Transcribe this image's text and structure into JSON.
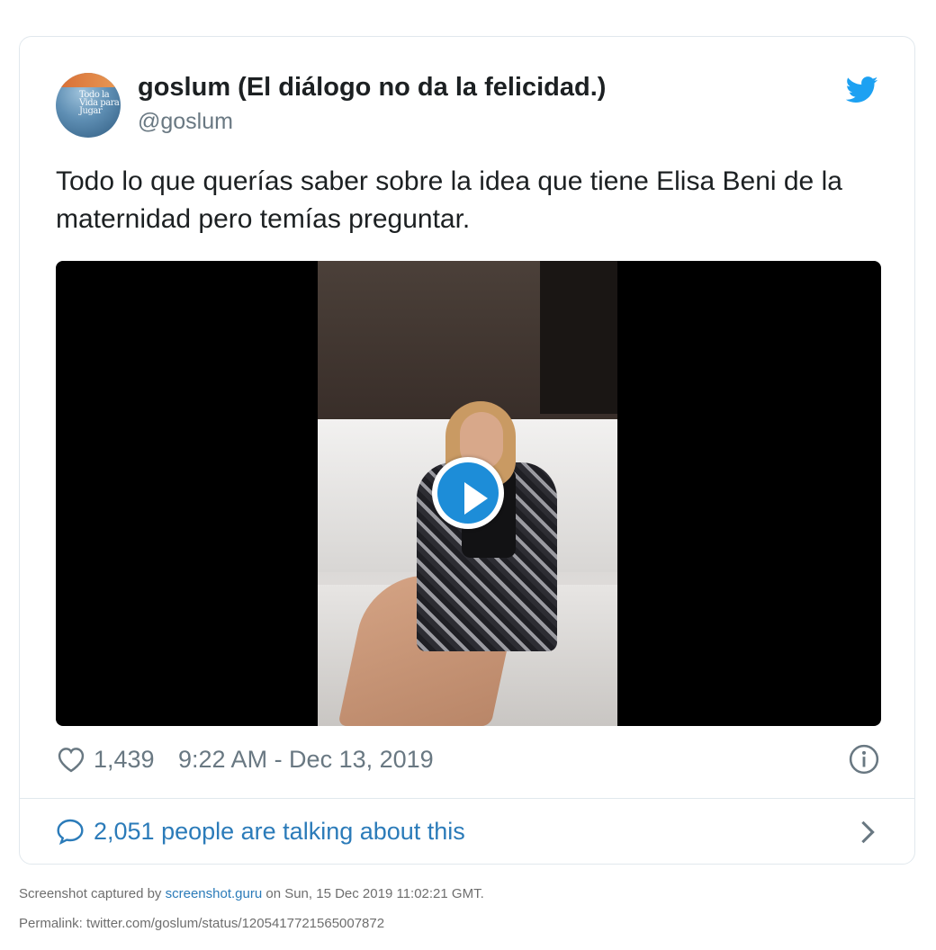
{
  "tweet": {
    "author_name": "goslum (El diálogo no da la felicidad.)",
    "author_handle": "@goslum",
    "avatar_text": "Todo la Vida para Jugar",
    "text": "Todo lo que querías saber sobre la idea que tiene Elisa Beni de la maternidad pero temías preguntar.",
    "like_count": "1,439",
    "timestamp": "9:22 AM - Dec 13, 2019",
    "talking_text": "2,051 people are talking about this",
    "icons": {
      "brand": "twitter-bird-icon",
      "like": "heart-icon",
      "info": "info-icon",
      "reply": "speech-bubble-icon",
      "navigate": "chevron-right-icon",
      "video": "play-icon"
    },
    "colors": {
      "brand": "#1da1f2",
      "link": "#2b7bb9",
      "muted": "#697882",
      "play_button": "#1d8dd8"
    }
  },
  "footer": {
    "capture_prefix": "Screenshot captured by ",
    "capture_link": "screenshot.guru",
    "capture_suffix": " on Sun, 15 Dec 2019 11:02:21 GMT.",
    "permalink": "Permalink: twitter.com/goslum/status/1205417721565007872"
  }
}
